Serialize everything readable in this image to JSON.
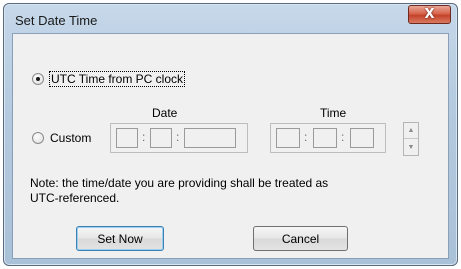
{
  "window": {
    "title": "Set Date Time",
    "close_glyph": "X"
  },
  "options": {
    "utc_label": "UTC Time from PC clock",
    "custom_label": "Custom",
    "selected": "utc"
  },
  "date": {
    "header": "Date",
    "separators": [
      ":",
      ":"
    ],
    "fields": [
      "",
      "",
      ""
    ]
  },
  "time": {
    "header": "Time",
    "separators": [
      ":",
      ":"
    ],
    "fields": [
      "",
      "",
      ""
    ]
  },
  "note": {
    "line1": "Note: the time/date you are providing shall be treated as",
    "line2": "UTC-referenced."
  },
  "buttons": {
    "set_now": "Set Now",
    "cancel": "Cancel"
  },
  "icons": {
    "close": "close-icon",
    "spin_up": "spin-up-icon",
    "spin_down": "spin-down-icon"
  }
}
